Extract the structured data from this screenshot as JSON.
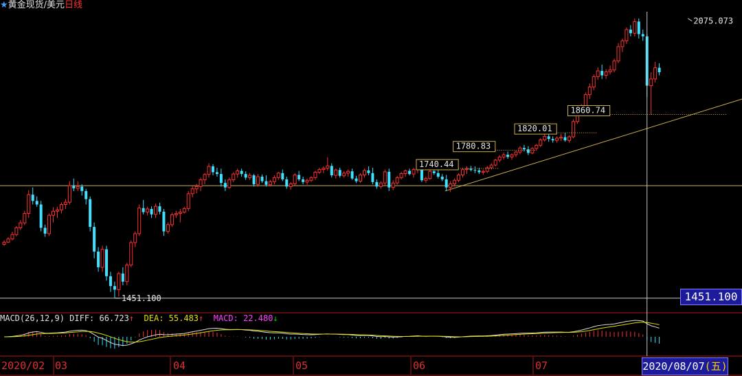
{
  "header": {
    "star_icon": "star-icon",
    "instrument": "黄金现货/美元",
    "period": "日线",
    "colors": {
      "instrument": "#e0e0e0",
      "period": "#ff3030",
      "star": "#40a0ff"
    }
  },
  "price_readout": "1451.100",
  "date_readout": {
    "date": "2020/08/07",
    "weekday": "(五)"
  },
  "chart_data": [
    {
      "type": "candlestick",
      "title": "黄金现货/美元 日线",
      "x_tick_labels": [
        "2020/02",
        "03",
        "04",
        "05",
        "06",
        "07"
      ],
      "y_range": [
        1440,
        2090
      ],
      "colors": {
        "up": "#ff3030",
        "down": "#40e0ff",
        "background": "#000000"
      },
      "annotations": [
        {
          "label": "2075.073",
          "value": 2075.073,
          "type": "high"
        },
        {
          "label": "1451.100",
          "value": 1451.1,
          "type": "low"
        },
        {
          "label": "1740.44",
          "value": 1740.44,
          "type": "level"
        },
        {
          "label": "1780.83",
          "value": 1780.83,
          "type": "level"
        },
        {
          "label": "1820.01",
          "value": 1820.01,
          "type": "level"
        },
        {
          "label": "1860.74",
          "value": 1860.74,
          "type": "level"
        }
      ],
      "horizontal_line": 1702,
      "crosshair_value": 1451.1,
      "trendline": [
        {
          "index": 108,
          "value": 1690
        },
        {
          "index": 178,
          "value": 1888
        }
      ],
      "ohlc": [
        [
          1571,
          1580,
          1568,
          1576
        ],
        [
          1576,
          1587,
          1574,
          1583
        ],
        [
          1583,
          1599,
          1580,
          1593
        ],
        [
          1593,
          1612,
          1589,
          1608
        ],
        [
          1608,
          1625,
          1603,
          1619
        ],
        [
          1619,
          1646,
          1614,
          1640
        ],
        [
          1640,
          1692,
          1630,
          1682
        ],
        [
          1682,
          1698,
          1660,
          1668
        ],
        [
          1668,
          1678,
          1655,
          1660
        ],
        [
          1660,
          1668,
          1600,
          1608
        ],
        [
          1608,
          1615,
          1588,
          1595
        ],
        [
          1595,
          1640,
          1590,
          1636
        ],
        [
          1636,
          1654,
          1620,
          1645
        ],
        [
          1645,
          1655,
          1630,
          1648
        ],
        [
          1648,
          1665,
          1640,
          1660
        ],
        [
          1660,
          1672,
          1650,
          1665
        ],
        [
          1665,
          1712,
          1660,
          1702
        ],
        [
          1702,
          1718,
          1690,
          1696
        ],
        [
          1696,
          1712,
          1690,
          1700
        ],
        [
          1700,
          1705,
          1680,
          1690
        ],
        [
          1690,
          1695,
          1660,
          1672
        ],
        [
          1672,
          1678,
          1600,
          1610
        ],
        [
          1610,
          1620,
          1540,
          1555
        ],
        [
          1555,
          1565,
          1510,
          1520
        ],
        [
          1520,
          1568,
          1510,
          1560
        ],
        [
          1560,
          1568,
          1490,
          1500
        ],
        [
          1500,
          1510,
          1465,
          1478
        ],
        [
          1478,
          1488,
          1451,
          1470
        ],
        [
          1470,
          1510,
          1455,
          1506
        ],
        [
          1506,
          1520,
          1480,
          1488
        ],
        [
          1488,
          1530,
          1480,
          1525
        ],
        [
          1525,
          1580,
          1520,
          1575
        ],
        [
          1575,
          1600,
          1565,
          1595
        ],
        [
          1595,
          1660,
          1590,
          1652
        ],
        [
          1652,
          1670,
          1638,
          1643
        ],
        [
          1643,
          1655,
          1636,
          1650
        ],
        [
          1650,
          1656,
          1630,
          1638
        ],
        [
          1638,
          1662,
          1630,
          1656
        ],
        [
          1656,
          1664,
          1638,
          1644
        ],
        [
          1644,
          1650,
          1590,
          1600
        ],
        [
          1600,
          1620,
          1595,
          1615
        ],
        [
          1615,
          1642,
          1610,
          1637
        ],
        [
          1637,
          1646,
          1630,
          1640
        ],
        [
          1640,
          1650,
          1620,
          1643
        ],
        [
          1643,
          1655,
          1640,
          1651
        ],
        [
          1651,
          1690,
          1645,
          1684
        ],
        [
          1684,
          1702,
          1676,
          1695
        ],
        [
          1695,
          1706,
          1685,
          1700
        ],
        [
          1700,
          1720,
          1690,
          1715
        ],
        [
          1715,
          1730,
          1705,
          1727
        ],
        [
          1727,
          1752,
          1720,
          1745
        ],
        [
          1745,
          1750,
          1725,
          1732
        ],
        [
          1732,
          1742,
          1722,
          1728
        ],
        [
          1728,
          1740,
          1700,
          1708
        ],
        [
          1708,
          1716,
          1690,
          1698
        ],
        [
          1698,
          1720,
          1695,
          1715
        ],
        [
          1715,
          1732,
          1710,
          1728
        ],
        [
          1728,
          1740,
          1720,
          1735
        ],
        [
          1735,
          1740,
          1722,
          1728
        ],
        [
          1728,
          1734,
          1715,
          1720
        ],
        [
          1720,
          1730,
          1715,
          1725
        ],
        [
          1725,
          1728,
          1700,
          1705
        ],
        [
          1705,
          1728,
          1700,
          1722
        ],
        [
          1722,
          1727,
          1708,
          1712
        ],
        [
          1712,
          1725,
          1700,
          1704
        ],
        [
          1704,
          1715,
          1700,
          1711
        ],
        [
          1711,
          1725,
          1705,
          1720
        ],
        [
          1720,
          1733,
          1715,
          1730
        ],
        [
          1730,
          1738,
          1712,
          1716
        ],
        [
          1716,
          1722,
          1695,
          1700
        ],
        [
          1700,
          1710,
          1693,
          1706
        ],
        [
          1706,
          1730,
          1703,
          1726
        ],
        [
          1726,
          1735,
          1712,
          1716
        ],
        [
          1716,
          1722,
          1705,
          1710
        ],
        [
          1710,
          1718,
          1704,
          1714
        ],
        [
          1714,
          1723,
          1710,
          1720
        ],
        [
          1720,
          1735,
          1715,
          1732
        ],
        [
          1732,
          1742,
          1728,
          1738
        ],
        [
          1738,
          1745,
          1730,
          1741
        ],
        [
          1741,
          1765,
          1736,
          1746
        ],
        [
          1746,
          1752,
          1720,
          1725
        ],
        [
          1725,
          1740,
          1718,
          1737
        ],
        [
          1737,
          1742,
          1720,
          1724
        ],
        [
          1724,
          1734,
          1720,
          1730
        ],
        [
          1730,
          1738,
          1722,
          1734
        ],
        [
          1734,
          1740,
          1715,
          1718
        ],
        [
          1718,
          1724,
          1708,
          1712
        ],
        [
          1712,
          1730,
          1708,
          1726
        ],
        [
          1726,
          1740,
          1720,
          1736
        ],
        [
          1736,
          1745,
          1725,
          1730
        ],
        [
          1730,
          1742,
          1705,
          1710
        ],
        [
          1710,
          1716,
          1695,
          1700
        ],
        [
          1700,
          1712,
          1695,
          1708
        ],
        [
          1708,
          1738,
          1702,
          1733
        ],
        [
          1733,
          1740,
          1690,
          1698
        ],
        [
          1698,
          1714,
          1692,
          1708
        ],
        [
          1708,
          1724,
          1704,
          1720
        ],
        [
          1720,
          1733,
          1716,
          1729
        ],
        [
          1729,
          1738,
          1722,
          1735
        ],
        [
          1735,
          1740,
          1725,
          1728
        ],
        [
          1728,
          1742,
          1720,
          1738
        ],
        [
          1738,
          1745,
          1730,
          1740
        ],
        [
          1740,
          1744,
          1710,
          1714
        ],
        [
          1714,
          1722,
          1708,
          1718
        ],
        [
          1718,
          1738,
          1715,
          1734
        ],
        [
          1734,
          1742,
          1726,
          1730
        ],
        [
          1730,
          1738,
          1718,
          1722
        ],
        [
          1722,
          1728,
          1712,
          1716
        ],
        [
          1716,
          1726,
          1690,
          1698
        ],
        [
          1698,
          1712,
          1688,
          1706
        ],
        [
          1706,
          1718,
          1700,
          1714
        ],
        [
          1714,
          1730,
          1710,
          1726
        ],
        [
          1726,
          1742,
          1720,
          1738
        ],
        [
          1738,
          1745,
          1728,
          1740
        ],
        [
          1740,
          1746,
          1734,
          1737
        ],
        [
          1737,
          1745,
          1730,
          1736
        ],
        [
          1736,
          1742,
          1728,
          1732
        ],
        [
          1732,
          1738,
          1726,
          1734
        ],
        [
          1734,
          1746,
          1730,
          1742
        ],
        [
          1742,
          1752,
          1738,
          1748
        ],
        [
          1748,
          1762,
          1745,
          1759
        ],
        [
          1759,
          1770,
          1754,
          1766
        ],
        [
          1766,
          1776,
          1760,
          1771
        ],
        [
          1771,
          1778,
          1762,
          1766
        ],
        [
          1766,
          1774,
          1760,
          1771
        ],
        [
          1771,
          1780,
          1766,
          1777
        ],
        [
          1777,
          1790,
          1772,
          1786
        ],
        [
          1786,
          1793,
          1778,
          1783
        ],
        [
          1783,
          1790,
          1770,
          1775
        ],
        [
          1775,
          1788,
          1772,
          1785
        ],
        [
          1785,
          1795,
          1780,
          1792
        ],
        [
          1792,
          1808,
          1788,
          1804
        ],
        [
          1804,
          1818,
          1800,
          1812
        ],
        [
          1812,
          1822,
          1800,
          1806
        ],
        [
          1806,
          1812,
          1798,
          1803
        ],
        [
          1803,
          1812,
          1798,
          1808
        ],
        [
          1808,
          1818,
          1802,
          1810
        ],
        [
          1810,
          1820,
          1800,
          1803
        ],
        [
          1803,
          1814,
          1798,
          1811
        ],
        [
          1811,
          1850,
          1808,
          1845
        ],
        [
          1845,
          1870,
          1840,
          1863
        ],
        [
          1863,
          1884,
          1858,
          1880
        ],
        [
          1880,
          1910,
          1875,
          1905
        ],
        [
          1905,
          1930,
          1895,
          1922
        ],
        [
          1922,
          1950,
          1915,
          1945
        ],
        [
          1945,
          1966,
          1938,
          1958
        ],
        [
          1958,
          1972,
          1940,
          1948
        ],
        [
          1948,
          1962,
          1940,
          1956
        ],
        [
          1956,
          1970,
          1950,
          1960
        ],
        [
          1960,
          1985,
          1955,
          1980
        ],
        [
          1980,
          2020,
          1975,
          2012
        ],
        [
          2012,
          2030,
          2000,
          2025
        ],
        [
          2025,
          2055,
          2018,
          2050
        ],
        [
          2050,
          2060,
          2035,
          2042
        ],
        [
          2042,
          2075,
          2035,
          2068
        ],
        [
          2068,
          2075,
          2030,
          2040
        ],
        [
          2040,
          2050,
          2025,
          2035
        ],
        [
          2035,
          2040,
          1900,
          1925
        ],
        [
          1925,
          1955,
          1860,
          1940
        ],
        [
          1940,
          1978,
          1932,
          1965
        ],
        [
          1965,
          1975,
          1948,
          1955
        ]
      ]
    },
    {
      "type": "line",
      "title": "MACD(26,12,9)",
      "legend": [
        {
          "label": "DIFF: 66.723",
          "arrow": "↑",
          "color": "#e0e0e0"
        },
        {
          "label": "DEA: 55.483",
          "arrow": "↑",
          "color": "#e0e000"
        },
        {
          "label": "MACD: 22.480",
          "arrow": "↓",
          "color": "#ff40ff"
        }
      ],
      "series": [
        {
          "name": "DIFF",
          "color": "#e0e0e0"
        },
        {
          "name": "DEA",
          "color": "#e0e000"
        },
        {
          "name": "MACD",
          "color": "#ff40ff"
        }
      ],
      "current": {
        "DIFF": 66.723,
        "DEA": 55.483,
        "MACD": 22.48
      }
    }
  ]
}
